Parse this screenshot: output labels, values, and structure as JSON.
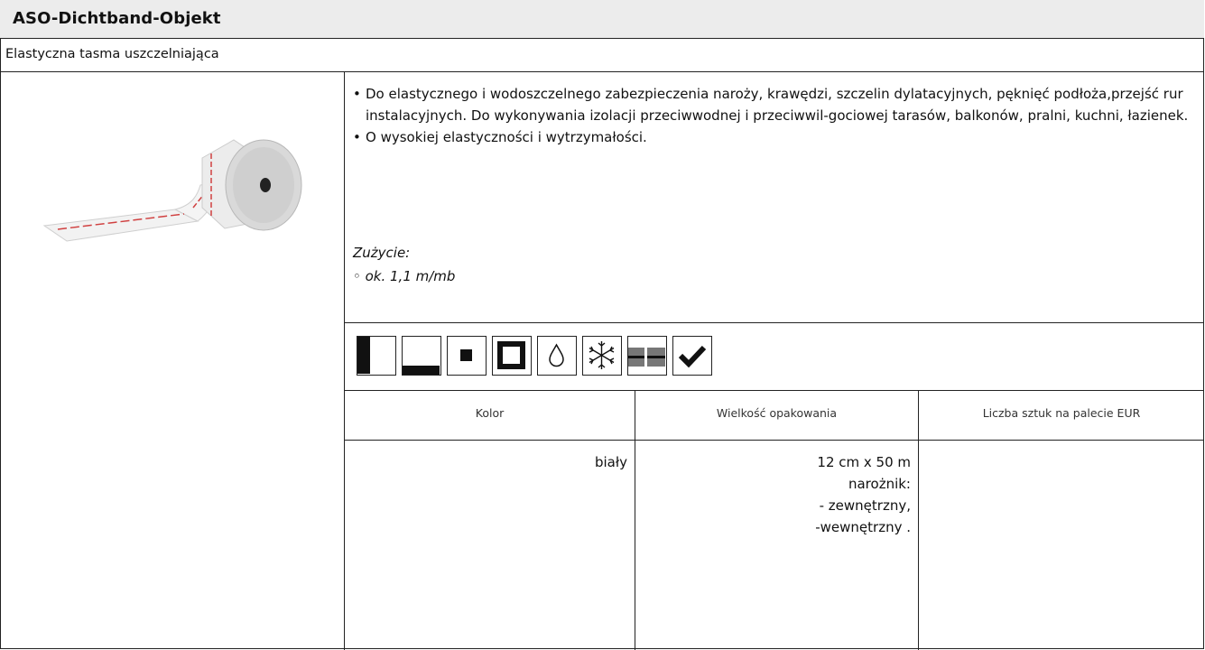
{
  "product": {
    "title": "ASO-Dichtband-Objekt",
    "subtitle": "Elastyczna tasma uszczelniająca"
  },
  "description": {
    "bullets": [
      "Do elastycznego i wodoszczelnego zabezpieczenia naroży, krawędzi, szczelin dylatacyjnych, pęknięć podłoża,przejść rur instalacyjnych. Do wykonywania izolacji przeciwwodnej i przeciwwil-gociowej tarasów, balkonów, pralni, kuchni, łazienek.",
      "O wysokiej elastyczności i wytrzymałości."
    ],
    "usage_label": "Zużycie:",
    "usage_item": "◦ ok. 1,1 m/mb"
  },
  "icons": [
    "wall-half-icon",
    "floor-icon",
    "small-square-icon",
    "large-frame-icon",
    "water-drop-icon",
    "frost-icon",
    "layers-icon",
    "checkmark-icon"
  ],
  "table": {
    "headers": [
      "Kolor",
      "Wielkość opakowania",
      "Liczba sztuk na palecie EUR"
    ],
    "row": {
      "color": "biały",
      "size_lines": [
        "12 cm x 50 m",
        "narożnik:",
        "- zewnętrzny,",
        "-wewnętrzny ."
      ],
      "pallet": ""
    }
  }
}
